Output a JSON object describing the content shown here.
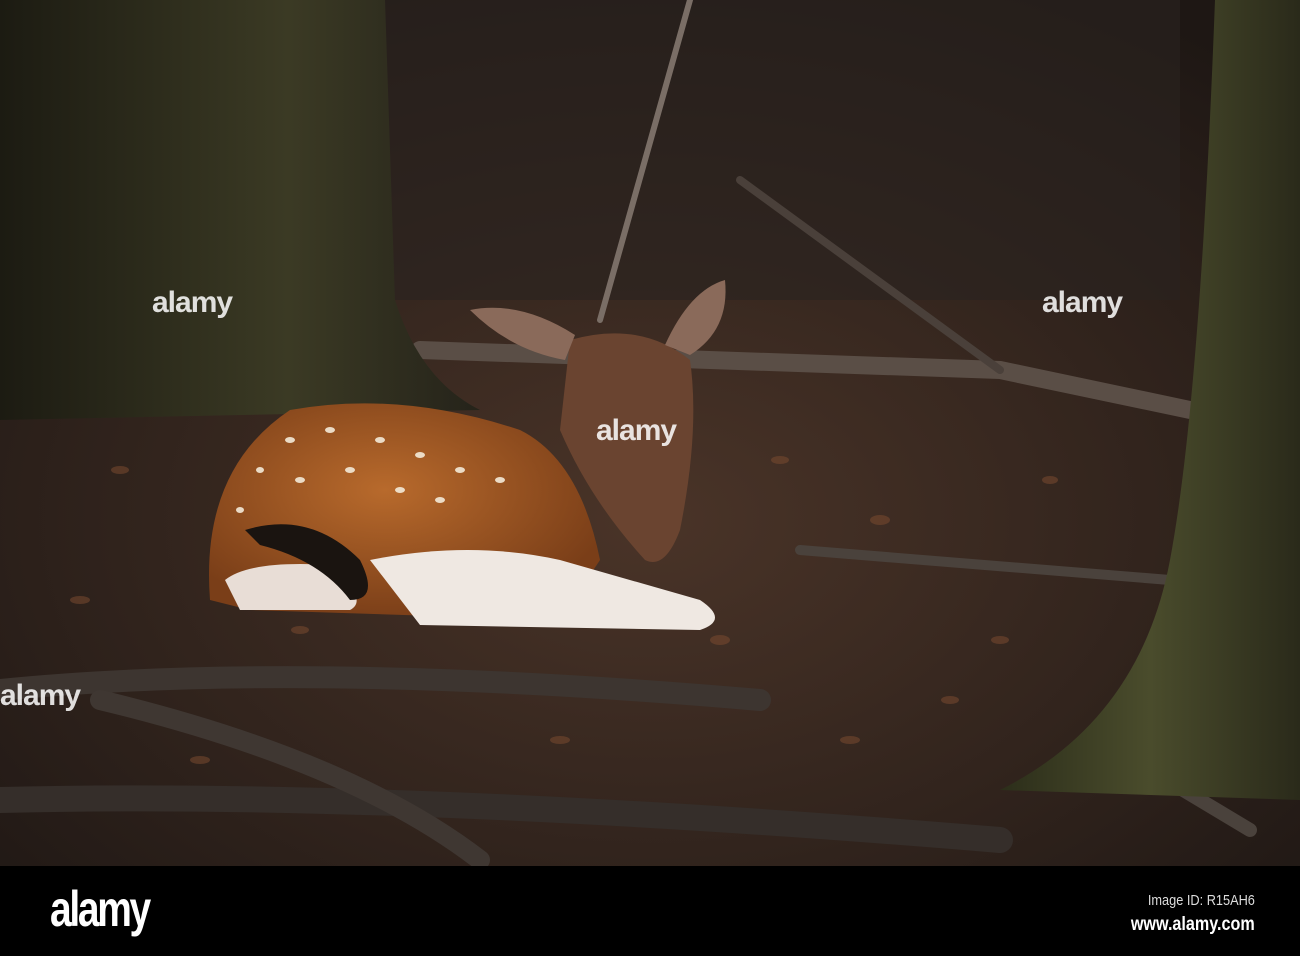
{
  "photo": {
    "subject": "fawn",
    "colors": {
      "ground": "#3a2a22",
      "trunk": "#3a3824",
      "fur": "#a85a22",
      "belly": "#f2ece6",
      "head": "#6a4430"
    }
  },
  "watermark": {
    "text": "alamy"
  },
  "footer": {
    "logo": "alamy",
    "image_id": "Image ID: R15AH6",
    "website": "www.alamy.com"
  }
}
